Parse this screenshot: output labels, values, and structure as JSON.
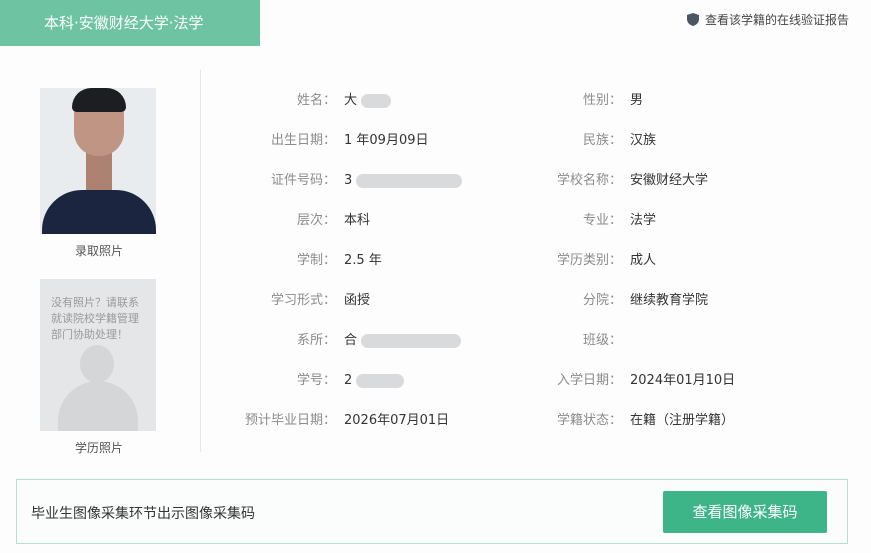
{
  "tab": {
    "title": "本科·安徽财经大学·法学"
  },
  "verify_link": "查看该学籍的在线验证报告",
  "photos": {
    "admission_caption": "录取照片",
    "placeholder_text": "没有照片？请联系就读院校学籍管理部门协助处理！",
    "degree_caption": "学历照片"
  },
  "fields_left": [
    {
      "label": "姓名：",
      "value": "大"
    },
    {
      "label": "出生日期：",
      "value": "1  年09月09日"
    },
    {
      "label": "证件号码：",
      "value": "3"
    },
    {
      "label": "层次：",
      "value": "本科"
    },
    {
      "label": "学制：",
      "value": "2.5 年"
    },
    {
      "label": "学习形式：",
      "value": "函授"
    },
    {
      "label": "系所：",
      "value": "合"
    },
    {
      "label": "学号：",
      "value": "2"
    },
    {
      "label": "预计毕业日期：",
      "value": "2026年07月01日"
    }
  ],
  "fields_right": [
    {
      "label": "性别：",
      "value": "男"
    },
    {
      "label": "民族：",
      "value": "汉族"
    },
    {
      "label": "学校名称：",
      "value": "安徽财经大学"
    },
    {
      "label": "专业：",
      "value": "法学"
    },
    {
      "label": "学历类别：",
      "value": "成人"
    },
    {
      "label": "分院：",
      "value": "继续教育学院"
    },
    {
      "label": "班级：",
      "value": ""
    },
    {
      "label": "入学日期：",
      "value": "2024年01月10日"
    },
    {
      "label": "学籍状态：",
      "value": "在籍（注册学籍）"
    }
  ],
  "bottom": {
    "message": "毕业生图像采集环节出示图像采集码",
    "button": "查看图像采集码"
  },
  "colors": {
    "accent": "#6ec4a2",
    "button": "#3eb489"
  }
}
